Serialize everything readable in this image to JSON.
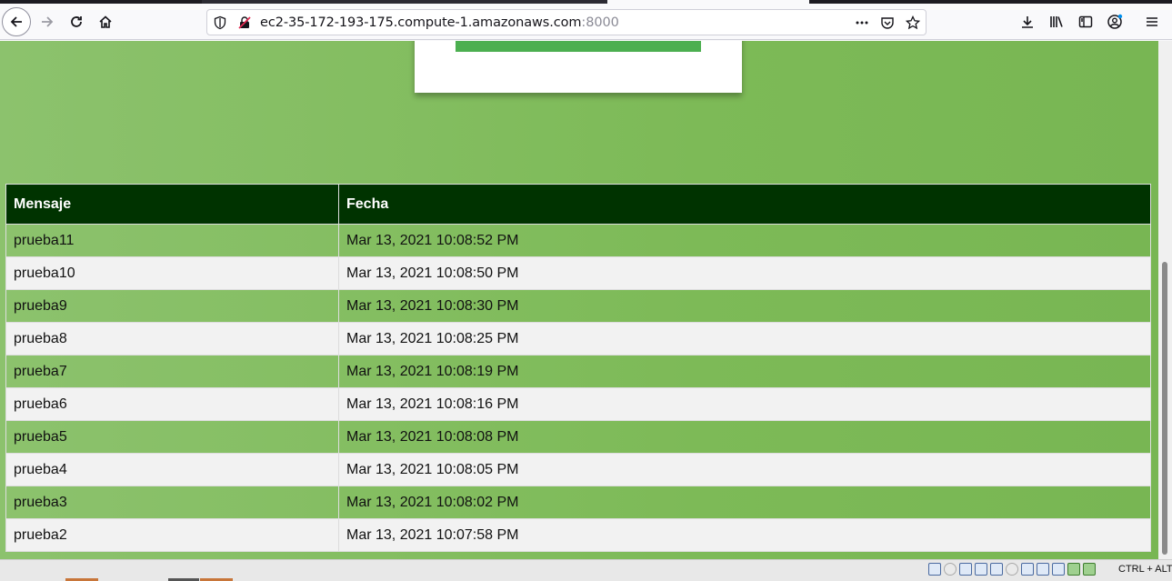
{
  "browser": {
    "url_host": "ec2-35-172-193-175.compute-1.amazonaws.com",
    "url_port": ":8000"
  },
  "table": {
    "headers": [
      "Mensaje",
      "Fecha"
    ],
    "rows": [
      {
        "mensaje": "prueba11",
        "fecha": "Mar 13, 2021 10:08:52 PM"
      },
      {
        "mensaje": "prueba10",
        "fecha": "Mar 13, 2021 10:08:50 PM"
      },
      {
        "mensaje": "prueba9",
        "fecha": "Mar 13, 2021 10:08:30 PM"
      },
      {
        "mensaje": "prueba8",
        "fecha": "Mar 13, 2021 10:08:25 PM"
      },
      {
        "mensaje": "prueba7",
        "fecha": "Mar 13, 2021 10:08:19 PM"
      },
      {
        "mensaje": "prueba6",
        "fecha": "Mar 13, 2021 10:08:16 PM"
      },
      {
        "mensaje": "prueba5",
        "fecha": "Mar 13, 2021 10:08:08 PM"
      },
      {
        "mensaje": "prueba4",
        "fecha": "Mar 13, 2021 10:08:05 PM"
      },
      {
        "mensaje": "prueba3",
        "fecha": "Mar 13, 2021 10:08:02 PM"
      },
      {
        "mensaje": "prueba2",
        "fecha": "Mar 13, 2021 10:07:58 PM"
      }
    ]
  },
  "statusbar": {
    "host_key": "CTRL + ALT"
  },
  "colors": {
    "page_green": "#7dba57",
    "header_dark_green": "#003300",
    "card_bar_green": "#4caf50",
    "row_alt": "#f2f2f2"
  },
  "icons": [
    "back-icon",
    "forward-icon",
    "reload-icon",
    "home-icon",
    "shield-icon",
    "insecure-lock-icon",
    "more-icon",
    "pocket-icon",
    "bookmark-star-icon",
    "download-icon",
    "library-icon",
    "sidebar-icon",
    "account-icon",
    "menu-icon"
  ]
}
